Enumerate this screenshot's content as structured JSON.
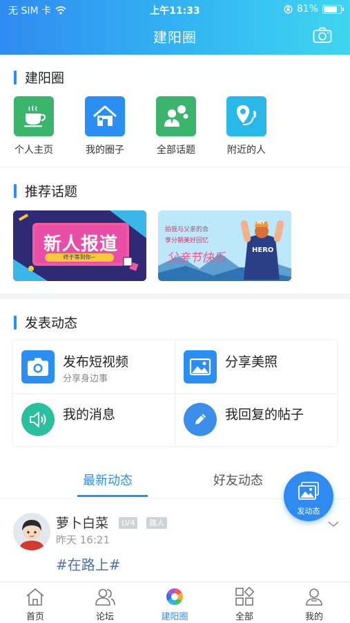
{
  "status": {
    "carrier": "无 SIM 卡",
    "time": "上午11:33",
    "battery": "81%",
    "battery_level": 0.81
  },
  "header": {
    "title": "建阳圈",
    "camera_icon": "camera-icon"
  },
  "section1": {
    "title": "建阳圈",
    "items": [
      {
        "label": "个人主页",
        "icon": "coffee-cup-icon",
        "color": "#3bb56e"
      },
      {
        "label": "我的圈子",
        "icon": "house-icon",
        "color": "#2a8ef2"
      },
      {
        "label": "全部话题",
        "icon": "person-chat-icon",
        "color": "#3bb56e"
      },
      {
        "label": "附近的人",
        "icon": "map-pin-icon",
        "color": "#2ab8e8"
      }
    ]
  },
  "section2": {
    "title": "推荐话题",
    "banners": [
      {
        "title": "新人报道",
        "subtitle": "终于等到你~"
      },
      {
        "title": "父亲节快乐",
        "line1": "拍我与父亲的合",
        "line2": "享分朝美好回忆",
        "shirt_text": "HERO",
        "cap_text": "MY"
      }
    ]
  },
  "section3": {
    "title": "发表动态",
    "items": [
      {
        "title": "发布短视频",
        "subtitle": "分享身边事",
        "icon": "camera-icon"
      },
      {
        "title": "分享美照",
        "subtitle": "",
        "icon": "image-icon"
      },
      {
        "title": "我的消息",
        "subtitle": "",
        "icon": "speaker-icon"
      },
      {
        "title": "我回复的帖子",
        "subtitle": "",
        "icon": "pencil-icon"
      }
    ]
  },
  "tabs": [
    {
      "label": "最新动态",
      "active": true
    },
    {
      "label": "好友动态",
      "active": false
    }
  ],
  "fab": {
    "label": "发动态"
  },
  "post": {
    "username": "萝卜白菜",
    "level": "LV4",
    "role": "路人",
    "time": "昨天 16:21",
    "tag": "#在路上#"
  },
  "bottom_nav": [
    {
      "label": "首页",
      "icon": "home-icon",
      "active": false
    },
    {
      "label": "论坛",
      "icon": "people-icon",
      "active": false
    },
    {
      "label": "建阳圈",
      "icon": "aperture-icon",
      "active": true
    },
    {
      "label": "全部",
      "icon": "grid-icon",
      "active": false
    },
    {
      "label": "我的",
      "icon": "user-icon",
      "active": false
    }
  ],
  "colors": {
    "accent": "#2a8ef2",
    "text": "#222222",
    "muted": "#999999",
    "tag": "#4d6fae"
  }
}
